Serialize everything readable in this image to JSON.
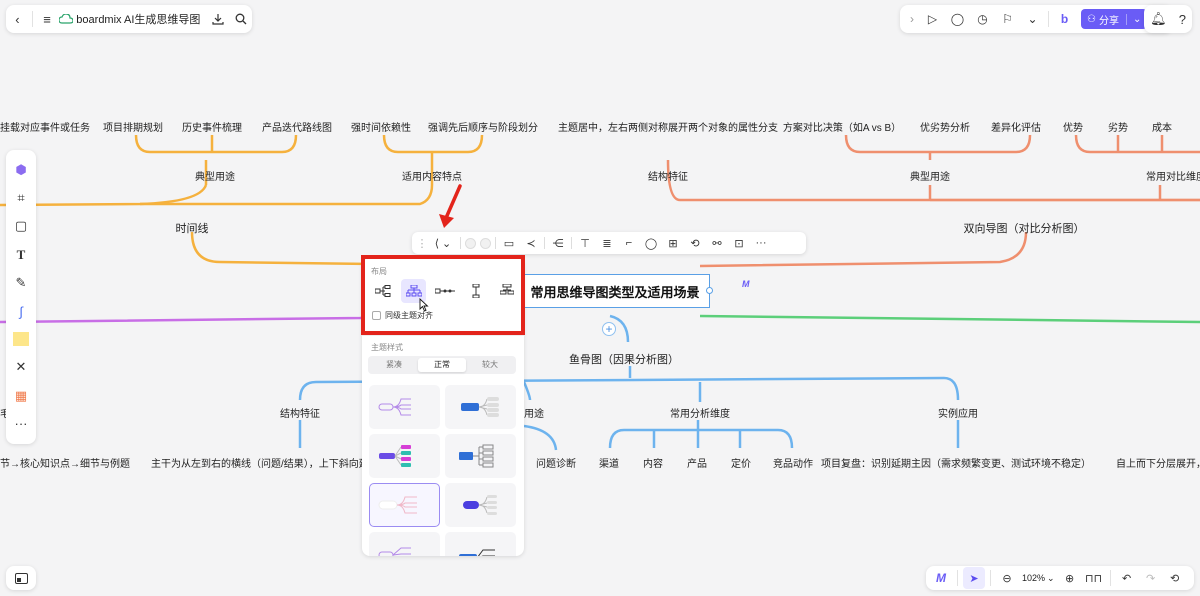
{
  "app": {
    "doc_title": "boardmix AI生成思维导图",
    "share_label": "分享"
  },
  "mindmap": {
    "central": "常用思维导图类型及适用场景",
    "branches": {
      "timeline": "时间线",
      "timeline_usage": "典型用途",
      "timeline_fit": "适用内容特点",
      "bidirectional": "双向导图（对比分析图）",
      "bi_structure": "结构特征",
      "bi_usage": "典型用途",
      "bi_dimension": "常用对比维度",
      "fishbone": "鱼骨图（因果分析图）",
      "fish_structure": "结构特征",
      "fish_usage": "用途",
      "fish_dimension": "常用分析维度",
      "fish_practice": "实例应用",
      "left_structure": "结构特征"
    },
    "leaves": {
      "t1": "挂载对应事件或任务",
      "t2": "项目排期规划",
      "t3": "历史事件梳理",
      "t4": "产品迭代路线图",
      "t5": "强时间依赖性",
      "t6": "强调先后顺序与阶段划分",
      "b1": "主题居中，左右两侧对称展开两个对象的属性分支",
      "b2": "方案对比决策（如A vs B）",
      "b3": "优劣势分析",
      "b4": "差异化评估",
      "b5": "优势",
      "b6": "劣势",
      "b7": "成本",
      "f1": "节→核心知识点→细节与例题",
      "f2": "主干为从左到右的横线（问题/结果），上下斜向延伸",
      "f3": "问题诊断",
      "f4": "渠道",
      "f5": "内容",
      "f6": "产品",
      "f7": "定价",
      "f8": "竞品动作",
      "f9": "项目复盘：识别延期主因（需求频繁变更、测试环境不稳定）",
      "f10": "自上而下分层展开，",
      "f11": "用途",
      "f12": "毛"
    }
  },
  "panel": {
    "layout_title": "布局",
    "align_label": "同级主题对齐",
    "style_title": "主题样式",
    "density": [
      "紧凑",
      "正常",
      "较大"
    ],
    "density_selected": "正常"
  },
  "zoom": {
    "level": "102%"
  },
  "colors": {
    "accent": "#6a5cf6",
    "orange": "#f5b13d",
    "salmon": "#ef8f6e",
    "blue": "#6db3ee",
    "purple": "#c86ee6",
    "green": "#5ccf7a",
    "highlight": "#e3241b"
  },
  "icons": {
    "back": "chevron-left-icon",
    "menu": "hamburger-icon",
    "cloud": "cloud-icon",
    "download": "download-icon",
    "search": "search-icon",
    "bell": "bell-icon",
    "undo": "undo-icon",
    "redo": "redo-icon"
  }
}
